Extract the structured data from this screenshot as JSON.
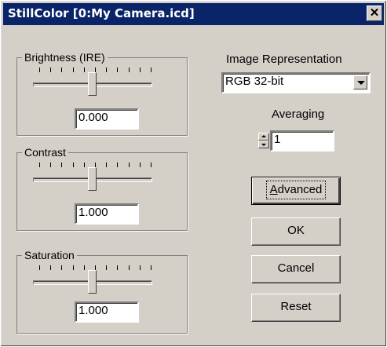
{
  "window": {
    "title": "StillColor [0:My Camera.icd]",
    "close_glyph": "✕"
  },
  "brightness": {
    "label": "Brightness (IRE)",
    "value": "0.000",
    "level": 0.5,
    "tick_count": 11
  },
  "contrast": {
    "label": "Contrast",
    "value": "1.000",
    "level": 0.5,
    "tick_count": 11
  },
  "saturation": {
    "label": "Saturation",
    "value": "1.000",
    "level": 0.5,
    "tick_count": 11
  },
  "image_representation": {
    "label": "Image Representation",
    "selected": "RGB 32-bit"
  },
  "averaging": {
    "label": "Averaging",
    "value": "1"
  },
  "buttons": {
    "advanced_prefix": "A",
    "advanced_rest": "dvanced",
    "ok": "OK",
    "cancel": "Cancel",
    "reset": "Reset"
  },
  "icons": {
    "close": "close-icon",
    "dropdown": "chevron-down-icon",
    "spin_up": "spin-up-icon",
    "spin_down": "spin-down-icon"
  },
  "colors": {
    "titlebar": "#0a246a",
    "face": "#d4d0c8"
  }
}
